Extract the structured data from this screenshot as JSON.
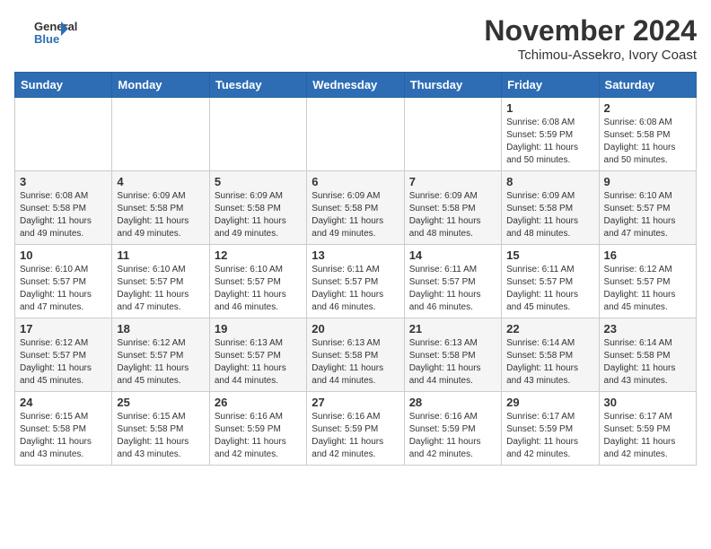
{
  "header": {
    "logo_general": "General",
    "logo_blue": "Blue",
    "month": "November 2024",
    "location": "Tchimou-Assekro, Ivory Coast"
  },
  "weekdays": [
    "Sunday",
    "Monday",
    "Tuesday",
    "Wednesday",
    "Thursday",
    "Friday",
    "Saturday"
  ],
  "weeks": [
    [
      {
        "day": "",
        "info": ""
      },
      {
        "day": "",
        "info": ""
      },
      {
        "day": "",
        "info": ""
      },
      {
        "day": "",
        "info": ""
      },
      {
        "day": "",
        "info": ""
      },
      {
        "day": "1",
        "info": "Sunrise: 6:08 AM\nSunset: 5:59 PM\nDaylight: 11 hours\nand 50 minutes."
      },
      {
        "day": "2",
        "info": "Sunrise: 6:08 AM\nSunset: 5:58 PM\nDaylight: 11 hours\nand 50 minutes."
      }
    ],
    [
      {
        "day": "3",
        "info": "Sunrise: 6:08 AM\nSunset: 5:58 PM\nDaylight: 11 hours\nand 49 minutes."
      },
      {
        "day": "4",
        "info": "Sunrise: 6:09 AM\nSunset: 5:58 PM\nDaylight: 11 hours\nand 49 minutes."
      },
      {
        "day": "5",
        "info": "Sunrise: 6:09 AM\nSunset: 5:58 PM\nDaylight: 11 hours\nand 49 minutes."
      },
      {
        "day": "6",
        "info": "Sunrise: 6:09 AM\nSunset: 5:58 PM\nDaylight: 11 hours\nand 49 minutes."
      },
      {
        "day": "7",
        "info": "Sunrise: 6:09 AM\nSunset: 5:58 PM\nDaylight: 11 hours\nand 48 minutes."
      },
      {
        "day": "8",
        "info": "Sunrise: 6:09 AM\nSunset: 5:58 PM\nDaylight: 11 hours\nand 48 minutes."
      },
      {
        "day": "9",
        "info": "Sunrise: 6:10 AM\nSunset: 5:57 PM\nDaylight: 11 hours\nand 47 minutes."
      }
    ],
    [
      {
        "day": "10",
        "info": "Sunrise: 6:10 AM\nSunset: 5:57 PM\nDaylight: 11 hours\nand 47 minutes."
      },
      {
        "day": "11",
        "info": "Sunrise: 6:10 AM\nSunset: 5:57 PM\nDaylight: 11 hours\nand 47 minutes."
      },
      {
        "day": "12",
        "info": "Sunrise: 6:10 AM\nSunset: 5:57 PM\nDaylight: 11 hours\nand 46 minutes."
      },
      {
        "day": "13",
        "info": "Sunrise: 6:11 AM\nSunset: 5:57 PM\nDaylight: 11 hours\nand 46 minutes."
      },
      {
        "day": "14",
        "info": "Sunrise: 6:11 AM\nSunset: 5:57 PM\nDaylight: 11 hours\nand 46 minutes."
      },
      {
        "day": "15",
        "info": "Sunrise: 6:11 AM\nSunset: 5:57 PM\nDaylight: 11 hours\nand 45 minutes."
      },
      {
        "day": "16",
        "info": "Sunrise: 6:12 AM\nSunset: 5:57 PM\nDaylight: 11 hours\nand 45 minutes."
      }
    ],
    [
      {
        "day": "17",
        "info": "Sunrise: 6:12 AM\nSunset: 5:57 PM\nDaylight: 11 hours\nand 45 minutes."
      },
      {
        "day": "18",
        "info": "Sunrise: 6:12 AM\nSunset: 5:57 PM\nDaylight: 11 hours\nand 45 minutes."
      },
      {
        "day": "19",
        "info": "Sunrise: 6:13 AM\nSunset: 5:57 PM\nDaylight: 11 hours\nand 44 minutes."
      },
      {
        "day": "20",
        "info": "Sunrise: 6:13 AM\nSunset: 5:58 PM\nDaylight: 11 hours\nand 44 minutes."
      },
      {
        "day": "21",
        "info": "Sunrise: 6:13 AM\nSunset: 5:58 PM\nDaylight: 11 hours\nand 44 minutes."
      },
      {
        "day": "22",
        "info": "Sunrise: 6:14 AM\nSunset: 5:58 PM\nDaylight: 11 hours\nand 43 minutes."
      },
      {
        "day": "23",
        "info": "Sunrise: 6:14 AM\nSunset: 5:58 PM\nDaylight: 11 hours\nand 43 minutes."
      }
    ],
    [
      {
        "day": "24",
        "info": "Sunrise: 6:15 AM\nSunset: 5:58 PM\nDaylight: 11 hours\nand 43 minutes."
      },
      {
        "day": "25",
        "info": "Sunrise: 6:15 AM\nSunset: 5:58 PM\nDaylight: 11 hours\nand 43 minutes."
      },
      {
        "day": "26",
        "info": "Sunrise: 6:16 AM\nSunset: 5:59 PM\nDaylight: 11 hours\nand 42 minutes."
      },
      {
        "day": "27",
        "info": "Sunrise: 6:16 AM\nSunset: 5:59 PM\nDaylight: 11 hours\nand 42 minutes."
      },
      {
        "day": "28",
        "info": "Sunrise: 6:16 AM\nSunset: 5:59 PM\nDaylight: 11 hours\nand 42 minutes."
      },
      {
        "day": "29",
        "info": "Sunrise: 6:17 AM\nSunset: 5:59 PM\nDaylight: 11 hours\nand 42 minutes."
      },
      {
        "day": "30",
        "info": "Sunrise: 6:17 AM\nSunset: 5:59 PM\nDaylight: 11 hours\nand 42 minutes."
      }
    ]
  ]
}
